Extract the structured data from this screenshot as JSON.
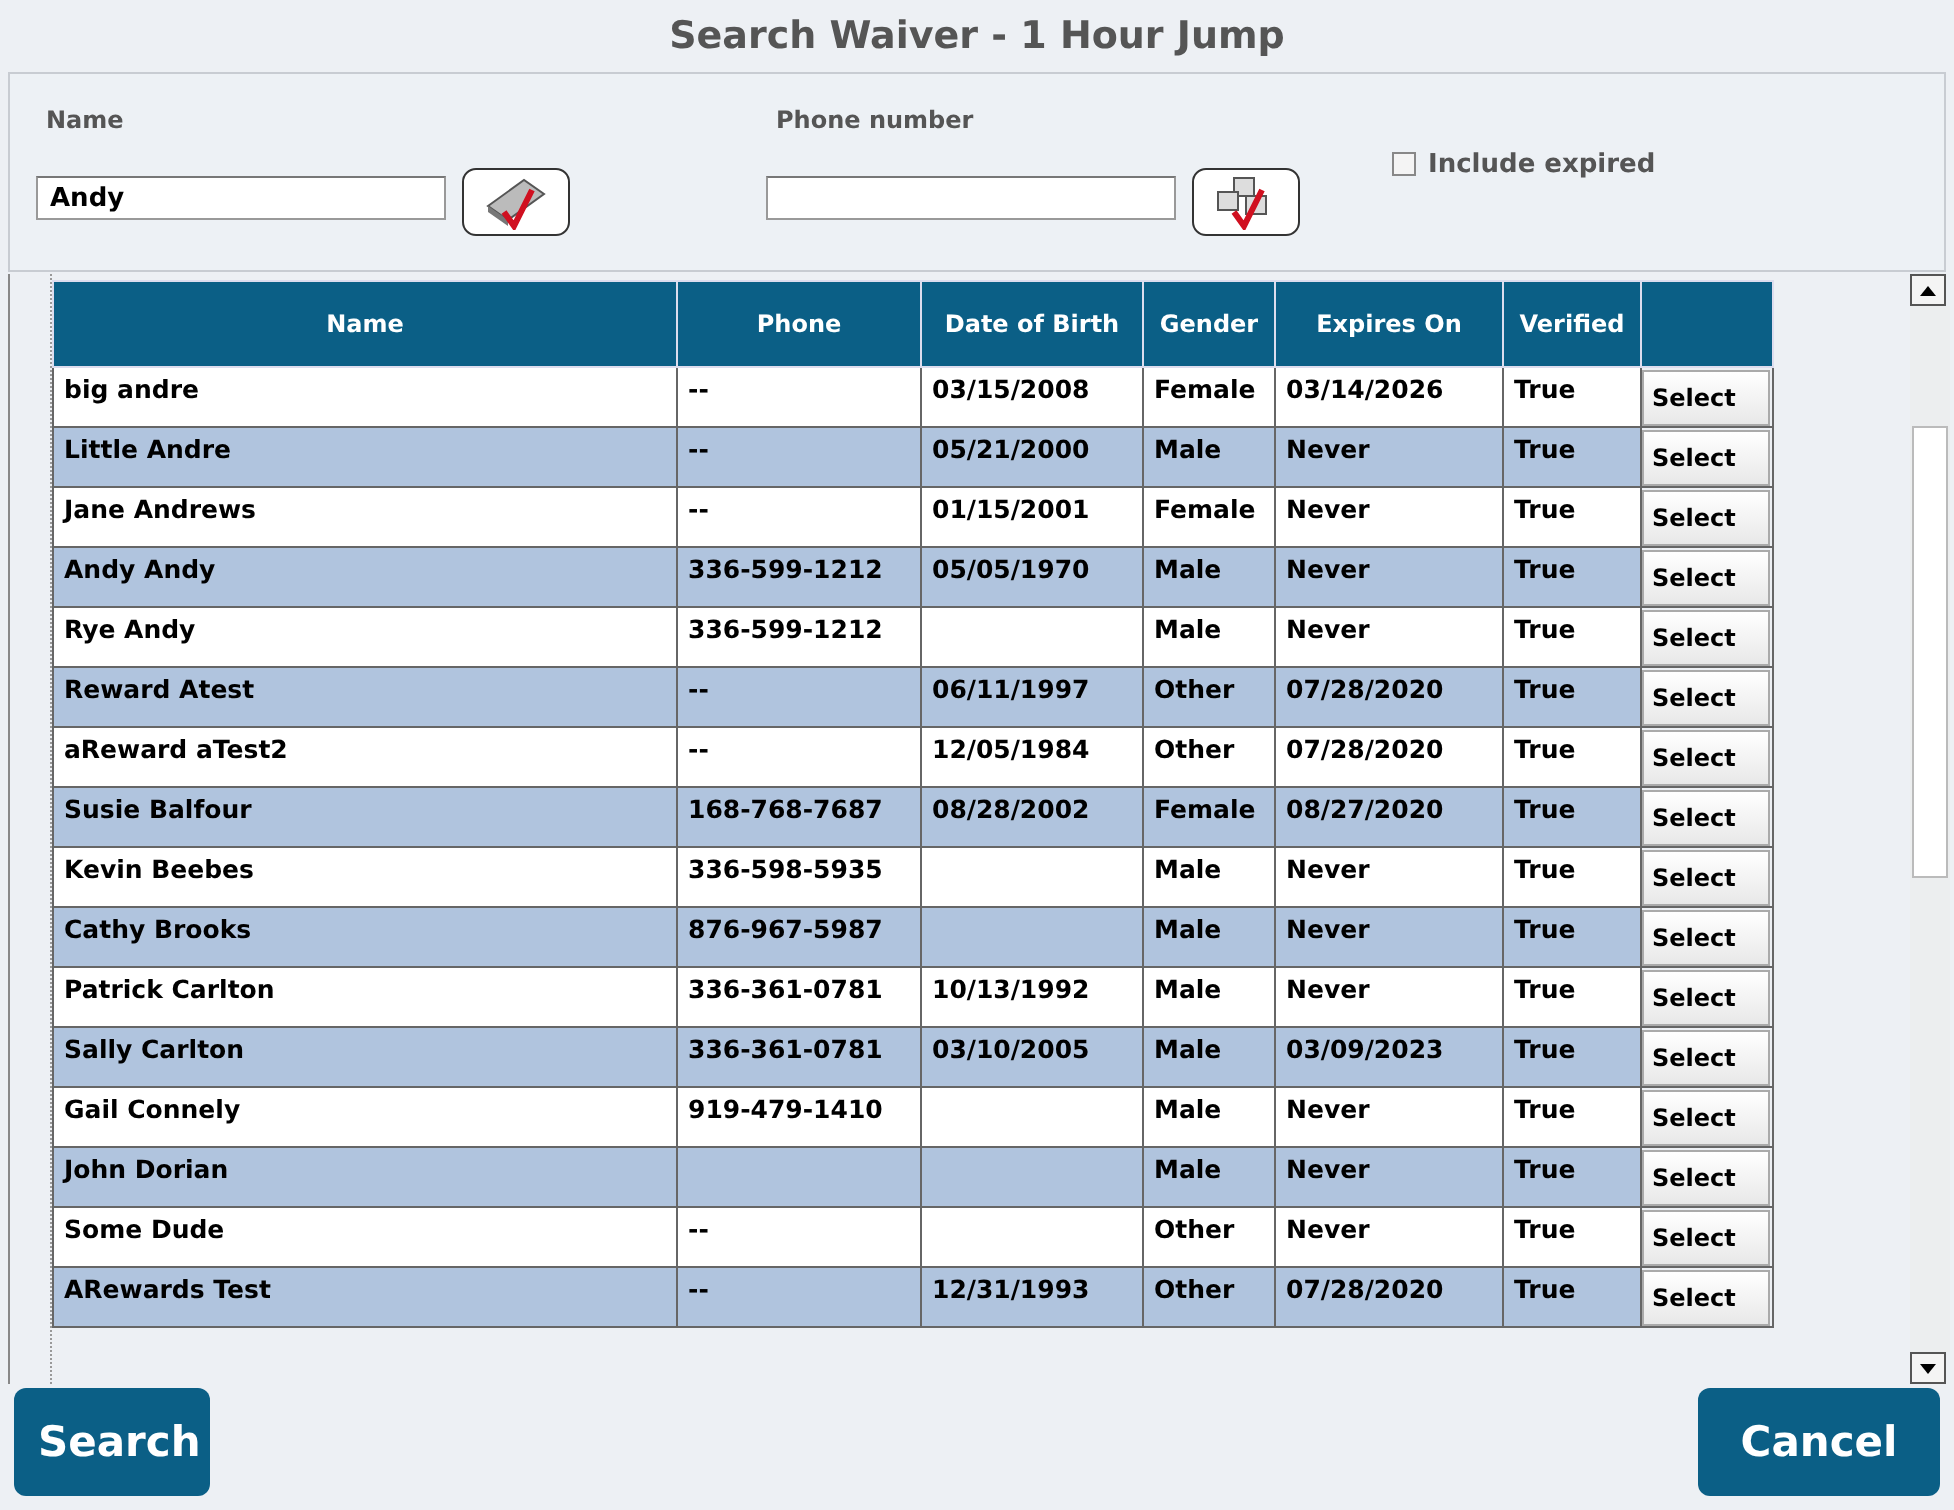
{
  "window": {
    "title": "Search Waiver - 1 Hour Jump"
  },
  "name_field": {
    "label": "Name",
    "value": "Andy"
  },
  "phone_field": {
    "label": "Phone number"
  },
  "include_expired": {
    "label": "Include expired",
    "checked": false
  },
  "table": {
    "columns": [
      "Name",
      "Phone",
      "Date of Birth",
      "Gender",
      "Expires On",
      "Verified"
    ],
    "rows": [
      {
        "name": "big andre",
        "phone": "--",
        "dob": "03/15/2008",
        "gender": "Female",
        "expires": "03/14/2026",
        "verified": "True",
        "action": "Select"
      },
      {
        "name": "Little Andre",
        "phone": "--",
        "dob": "05/21/2000",
        "gender": "Male",
        "expires": "Never",
        "verified": "True",
        "action": "Select"
      },
      {
        "name": "Jane Andrews",
        "phone": "--",
        "dob": "01/15/2001",
        "gender": "Female",
        "expires": "Never",
        "verified": "True",
        "action": "Select"
      },
      {
        "name": "Andy Andy",
        "phone": "336-599-1212",
        "dob": "05/05/1970",
        "gender": "Male",
        "expires": "Never",
        "verified": "True",
        "action": "Select"
      },
      {
        "name": "Rye Andy",
        "phone": "336-599-1212",
        "gender": "Male",
        "expires": "Never",
        "verified": "True",
        "action": "Select"
      },
      {
        "name": "Reward Atest",
        "phone": "--",
        "dob": "06/11/1997",
        "gender": "Other",
        "expires": "07/28/2020",
        "verified": "True",
        "action": "Select"
      },
      {
        "name": "aReward aTest2",
        "phone": "--",
        "dob": "12/05/1984",
        "gender": "Other",
        "expires": "07/28/2020",
        "verified": "True",
        "action": "Select"
      },
      {
        "name": "Susie Balfour",
        "phone": "168-768-7687",
        "dob": "08/28/2002",
        "gender": "Female",
        "expires": "08/27/2020",
        "verified": "True",
        "action": "Select"
      },
      {
        "name": "Kevin Beebes",
        "phone": "336-598-5935",
        "gender": "Male",
        "expires": "Never",
        "verified": "True",
        "action": "Select"
      },
      {
        "name": "Cathy Brooks",
        "phone": "876-967-5987",
        "gender": "Male",
        "expires": "Never",
        "verified": "True",
        "action": "Select"
      },
      {
        "name": "Patrick Carlton",
        "phone": "336-361-0781",
        "dob": "10/13/1992",
        "gender": "Male",
        "expires": "Never",
        "verified": "True",
        "action": "Select"
      },
      {
        "name": "Sally Carlton",
        "phone": "336-361-0781",
        "dob": "03/10/2005",
        "gender": "Male",
        "expires": "03/09/2023",
        "verified": "True",
        "action": "Select"
      },
      {
        "name": "Gail Connely",
        "phone": "919-479-1410",
        "gender": "Male",
        "expires": "Never",
        "verified": "True",
        "action": "Select"
      },
      {
        "name": "John Dorian",
        "gender": "Male",
        "expires": "Never",
        "verified": "True",
        "action": "Select"
      },
      {
        "name": "Some Dude",
        "phone": "--",
        "gender": "Other",
        "expires": "Never",
        "verified": "True",
        "action": "Select"
      },
      {
        "name": "ARewards Test",
        "phone": "--",
        "dob": "12/31/1993",
        "gender": "Other",
        "expires": "07/28/2020",
        "verified": "True",
        "action": "Select"
      }
    ]
  },
  "buttons": {
    "search": "Search",
    "cancel": "Cancel"
  }
}
